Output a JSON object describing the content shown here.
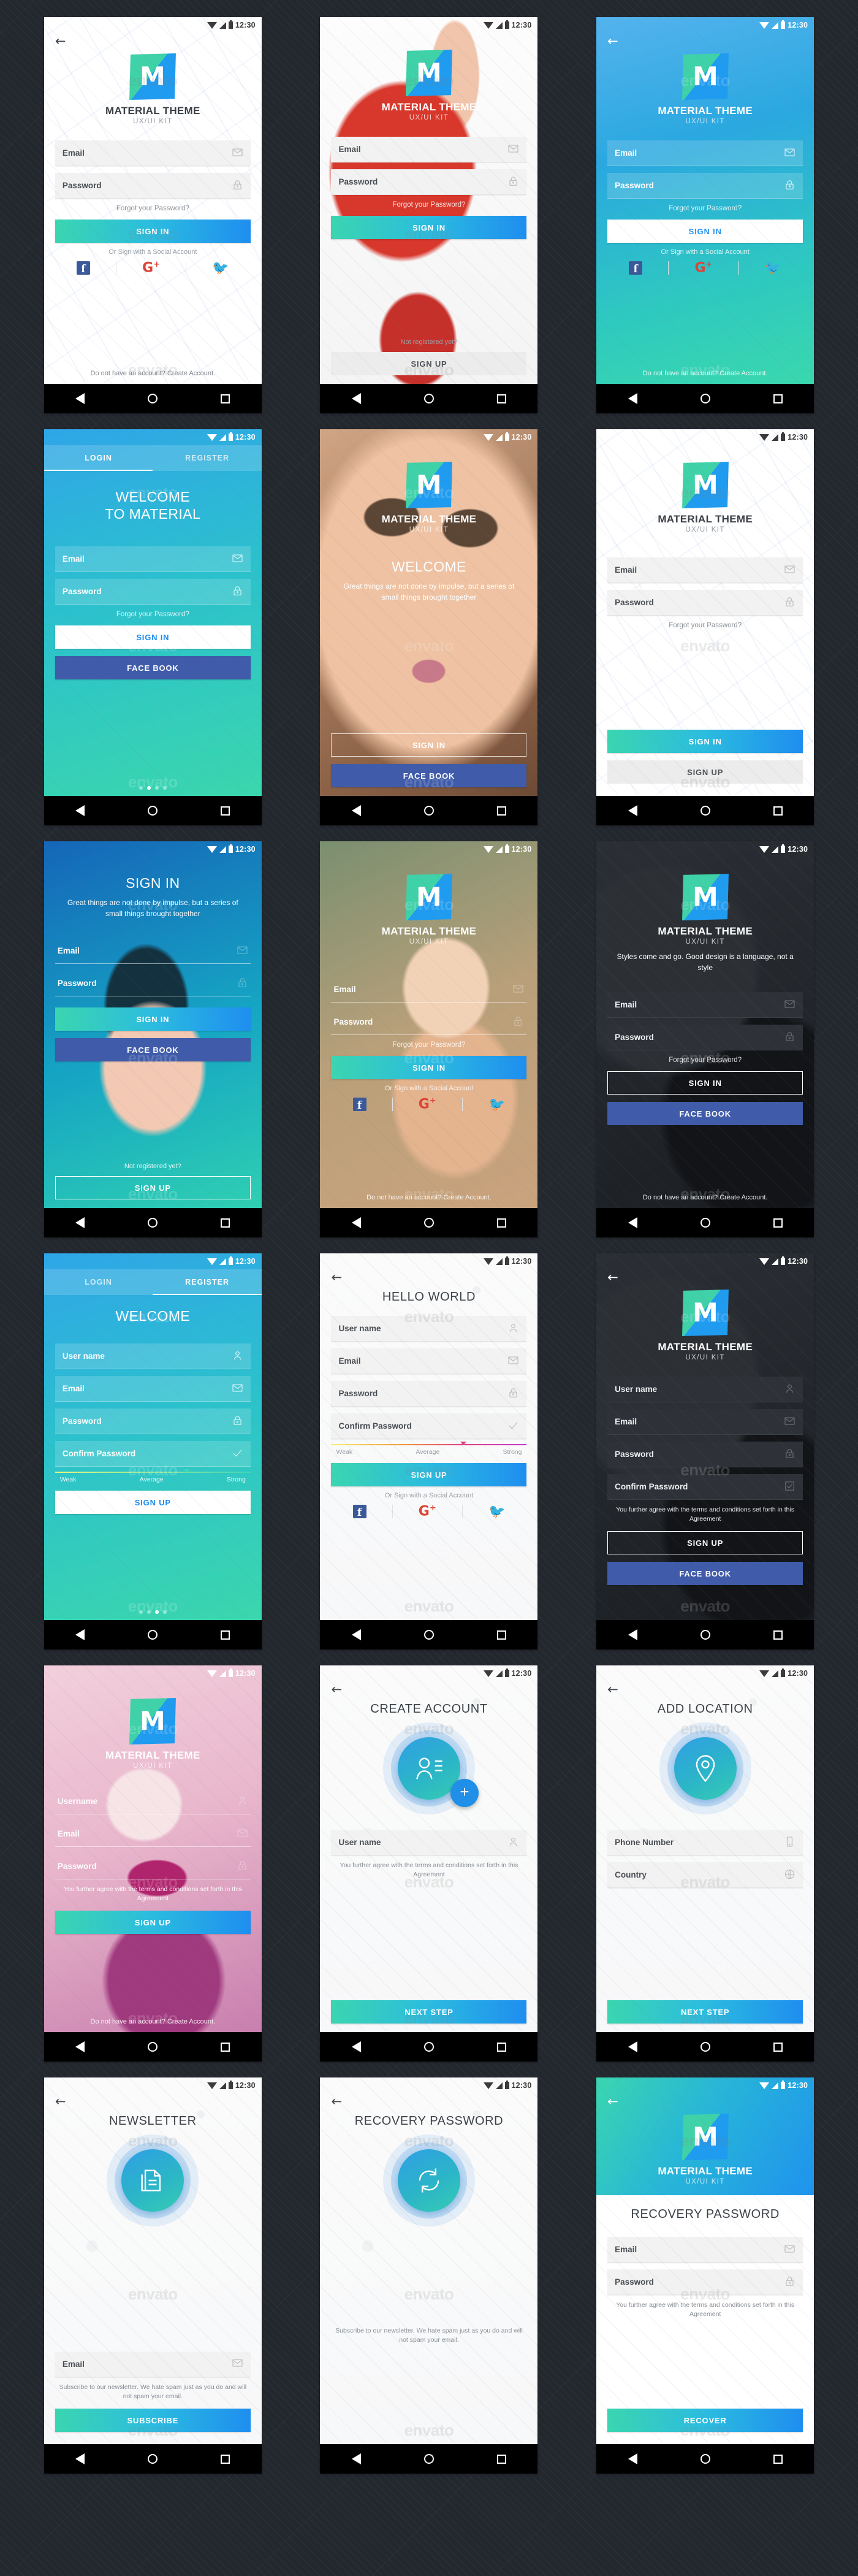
{
  "watermark": "envato",
  "status": {
    "time": "12:30"
  },
  "brand": {
    "name": "MATERIAL THEME",
    "tagline": "UX/UI KIT",
    "logo_letter": "M"
  },
  "labels": {
    "email": "Email",
    "password": "Password",
    "user_name": "User name",
    "username_alt": "Username",
    "confirm_password": "Confirm Password",
    "phone_number": "Phone Number",
    "country": "Country",
    "forgot": "Forgot your Password?",
    "sign_in": "SIGN IN",
    "sign_up": "SIGN UP",
    "face_book": "FACE BOOK",
    "next_step": "NEXT STEP",
    "subscribe": "SUBSCRIBE",
    "recover": "RECOVER",
    "or_social": "Or Sign with a Social Account",
    "no_account": "Do not have an account? Create Account.",
    "not_registered": "Not registered yet?",
    "login_tab": "LOGIN",
    "register_tab": "REGISTER",
    "welcome": "WELCOME",
    "welcome_to_material_l1": "WELCOME",
    "welcome_to_material_l2": "TO MATERIAL",
    "hello_world": "HELLO WORLD",
    "create_account": "CREATE ACCOUNT",
    "add_location": "ADD LOCATION",
    "newsletter": "NEWSLETTER",
    "recovery_password": "RECOVERY PASSWORD",
    "sign_in_title": "SIGN IN",
    "weak": "Weak",
    "average": "Average",
    "strong": "Strong",
    "quote_impulse": "Great things are not done by impulse, but a series of small things brought together",
    "quote_impulse_b": "Great things are not done by impulse, but a series of small things brought together",
    "quote_styles": "Styles come and go. Good design is a language, not a style",
    "agreement": "You further agree with the terms and conditions set forth in this Agreement",
    "newsletter_note": "Subscribe to our newsletter. We hate spam just as you do and will not spam your email."
  },
  "colors": {
    "accent_green": "#3ad6b0",
    "accent_blue": "#1e8ef0",
    "facebook": "#3f5ba9",
    "google": "#db4437",
    "twitter": "#1da1f2",
    "dark_bg": "#23272e"
  },
  "screens": [
    {
      "id": 1,
      "title": "Sign In Light",
      "theme": "light"
    },
    {
      "id": 2,
      "title": "Sign In Bag Photo",
      "theme": "image"
    },
    {
      "id": 3,
      "title": "Sign In Gradient",
      "theme": "gradient"
    },
    {
      "id": 4,
      "title": "Login Tabs Gradient",
      "theme": "gradient"
    },
    {
      "id": 5,
      "title": "Welcome Face Photo",
      "theme": "image"
    },
    {
      "id": 6,
      "title": "Sign In Plain",
      "theme": "light"
    },
    {
      "id": 7,
      "title": "Sign In Blue Photo",
      "theme": "image"
    },
    {
      "id": 8,
      "title": "Sign In Girl Photo",
      "theme": "image"
    },
    {
      "id": 9,
      "title": "Sign In Dark",
      "theme": "dark"
    },
    {
      "id": 10,
      "title": "Register Tabs",
      "theme": "gradient"
    },
    {
      "id": 11,
      "title": "Hello World",
      "theme": "light"
    },
    {
      "id": 12,
      "title": "Register Dark",
      "theme": "dark"
    },
    {
      "id": 13,
      "title": "Sign Up Pink Photo",
      "theme": "image"
    },
    {
      "id": 14,
      "title": "Create Account",
      "theme": "light"
    },
    {
      "id": 15,
      "title": "Add Location",
      "theme": "light"
    },
    {
      "id": 16,
      "title": "Newsletter",
      "theme": "light"
    },
    {
      "id": 17,
      "title": "Recovery Password",
      "theme": "light"
    },
    {
      "id": 18,
      "title": "Recovery Gradient",
      "theme": "gradient"
    }
  ]
}
